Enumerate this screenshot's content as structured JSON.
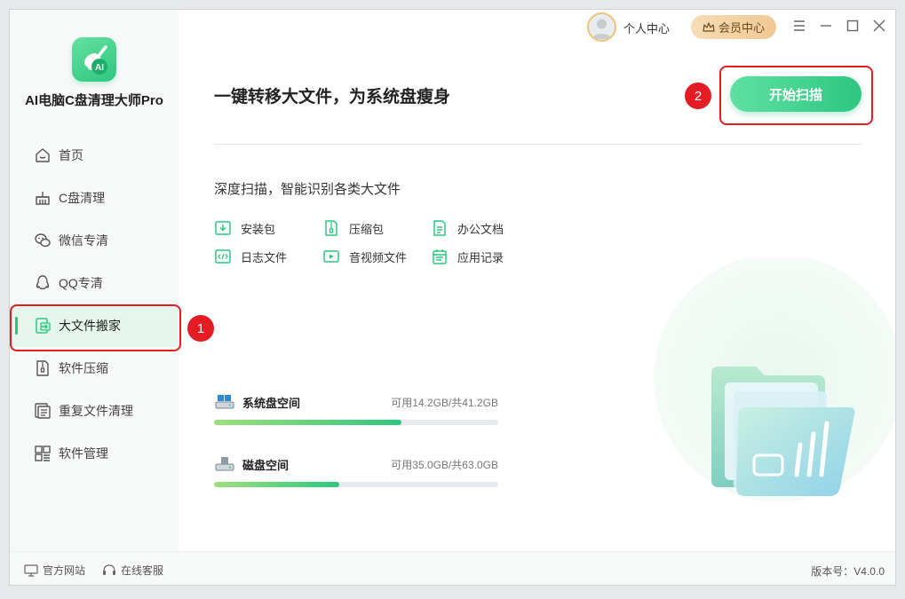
{
  "app": {
    "name": "AI电脑C盘清理大师Pro",
    "logo_text": "AI"
  },
  "sidebar": {
    "items": [
      {
        "label": "首页",
        "icon": "home-icon"
      },
      {
        "label": "C盘清理",
        "icon": "broom-icon"
      },
      {
        "label": "微信专清",
        "icon": "wechat-icon"
      },
      {
        "label": "QQ专清",
        "icon": "qq-penguin-icon"
      },
      {
        "label": "大文件搬家",
        "icon": "file-move-icon",
        "active": true
      },
      {
        "label": "软件压缩",
        "icon": "zip-icon"
      },
      {
        "label": "重复文件清理",
        "icon": "duplicate-file-icon"
      },
      {
        "label": "软件管理",
        "icon": "apps-grid-icon"
      }
    ]
  },
  "topbar": {
    "user_center": "个人中心",
    "vip_center": "会员中心",
    "icons": [
      "menu-icon",
      "minimize-icon",
      "maximize-icon",
      "close-icon"
    ]
  },
  "main": {
    "title": "一键转移大文件，为系统盘瘦身",
    "scan_button": "开始扫描",
    "section_desc": "深度扫描，智能识别各类大文件",
    "file_types": [
      {
        "label": "安装包",
        "icon": "installer-icon"
      },
      {
        "label": "压缩包",
        "icon": "archive-icon"
      },
      {
        "label": "办公文档",
        "icon": "document-icon"
      },
      {
        "label": "日志文件",
        "icon": "code-file-icon"
      },
      {
        "label": "音视频文件",
        "icon": "video-icon"
      },
      {
        "label": "应用记录",
        "icon": "calendar-icon"
      }
    ],
    "disks": [
      {
        "name": "系统盘空间",
        "usage": "可用14.2GB/共41.2GB",
        "used_fraction": 0.66,
        "icon": "system-drive-icon"
      },
      {
        "name": "磁盘空间",
        "usage": "可用35.0GB/共63.0GB",
        "used_fraction": 0.44,
        "icon": "drive-icon"
      }
    ]
  },
  "annotations": {
    "badge_1": "1",
    "badge_2": "2"
  },
  "footer": {
    "website": "官方网站",
    "support": "在线客服",
    "version": "版本号：V4.0.0"
  },
  "colors": {
    "accent": "#2dc77f",
    "highlight": "#e51c23",
    "sidebar_bg": "#f7f9f9",
    "active_item_bg": "#e5f6ec"
  }
}
